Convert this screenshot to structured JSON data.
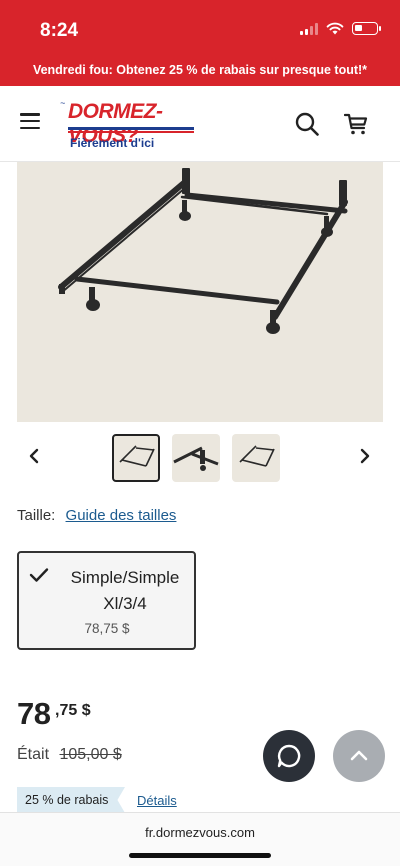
{
  "status_bar": {
    "time": "8:24"
  },
  "promo": {
    "text": "Vendredi fou: Obtenez 25 % de rabais sur presque tout!*"
  },
  "header": {
    "logo_text": "Dormez-vous?",
    "logo_tagline": "Fièrement d'ici",
    "icons": {
      "menu": "hamburger-menu-icon",
      "search": "search-icon",
      "cart": "cart-icon"
    }
  },
  "gallery": {
    "thumbnail_count": 3,
    "active_thumbnail": 1
  },
  "size": {
    "label": "Taille:",
    "guide_link": "Guide des tailles",
    "options": [
      {
        "name": "Simple/Simple Xl/3/4",
        "price": "78,75 $",
        "selected": true
      }
    ]
  },
  "price": {
    "dollars": "78",
    "cents": ",75 $",
    "was_label": "Était",
    "was_price": "105,00 $",
    "discount_badge": "25 % de rabais",
    "details_link": "Détails"
  },
  "browser": {
    "url": "fr.dormezvous.com"
  },
  "colors": {
    "brand_red": "#d8242b",
    "brand_blue": "#1c3d8f",
    "link_blue": "#1c5b8f",
    "badge_bg": "#dcebf3"
  }
}
